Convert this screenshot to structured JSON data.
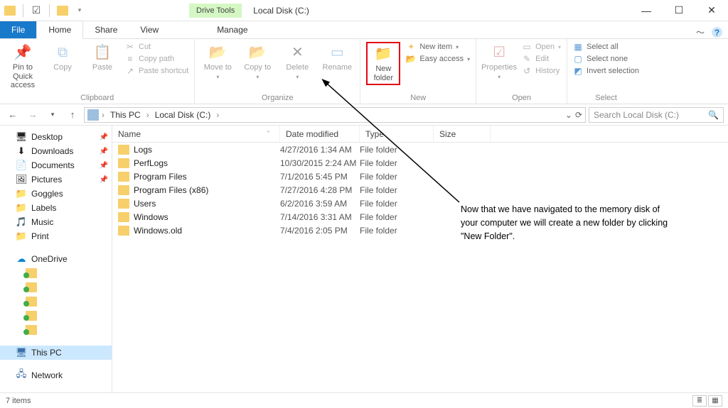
{
  "window": {
    "title": "Local Disk (C:)",
    "drive_tools": "Drive Tools"
  },
  "tabs": {
    "file": "File",
    "home": "Home",
    "share": "Share",
    "view": "View",
    "manage": "Manage"
  },
  "ribbon": {
    "clipboard": {
      "label": "Clipboard",
      "pin": "Pin to Quick access",
      "copy": "Copy",
      "paste": "Paste",
      "cut": "Cut",
      "copy_path": "Copy path",
      "paste_shortcut": "Paste shortcut"
    },
    "organize": {
      "label": "Organize",
      "move_to": "Move to",
      "copy_to": "Copy to",
      "delete": "Delete",
      "rename": "Rename"
    },
    "new": {
      "label": "New",
      "new_folder": "New folder",
      "new_item": "New item",
      "easy_access": "Easy access"
    },
    "open": {
      "label": "Open",
      "properties": "Properties",
      "open": "Open",
      "edit": "Edit",
      "history": "History"
    },
    "select": {
      "label": "Select",
      "select_all": "Select all",
      "select_none": "Select none",
      "invert": "Invert selection"
    }
  },
  "breadcrumb": {
    "root": "This PC",
    "current": "Local Disk (C:)"
  },
  "search": {
    "placeholder": "Search Local Disk (C:)"
  },
  "sidebar": {
    "quick": [
      {
        "label": "Desktop",
        "pin": true,
        "icon": "🖥"
      },
      {
        "label": "Downloads",
        "pin": true,
        "icon": "⬇"
      },
      {
        "label": "Documents",
        "pin": true,
        "icon": "📄"
      },
      {
        "label": "Pictures",
        "pin": true,
        "icon": "🖼"
      },
      {
        "label": "Goggles",
        "pin": false,
        "icon": "📁"
      },
      {
        "label": "Labels",
        "pin": false,
        "icon": "📁"
      },
      {
        "label": "Music",
        "pin": false,
        "icon": "🎵"
      },
      {
        "label": "Print",
        "pin": false,
        "icon": "📁"
      }
    ],
    "onedrive": "OneDrive",
    "thispc": "This PC",
    "network": "Network"
  },
  "columns": {
    "name": "Name",
    "date": "Date modified",
    "type": "Type",
    "size": "Size"
  },
  "files": [
    {
      "name": "Logs",
      "date": "4/27/2016 1:34 AM",
      "type": "File folder"
    },
    {
      "name": "PerfLogs",
      "date": "10/30/2015 2:24 AM",
      "type": "File folder"
    },
    {
      "name": "Program Files",
      "date": "7/1/2016 5:45 PM",
      "type": "File folder"
    },
    {
      "name": "Program Files (x86)",
      "date": "7/27/2016 4:28 PM",
      "type": "File folder"
    },
    {
      "name": "Users",
      "date": "6/2/2016 3:59 AM",
      "type": "File folder"
    },
    {
      "name": "Windows",
      "date": "7/14/2016 3:31 AM",
      "type": "File folder"
    },
    {
      "name": "Windows.old",
      "date": "7/4/2016 2:05 PM",
      "type": "File folder"
    }
  ],
  "status": {
    "count": "7 items"
  },
  "annotation": {
    "line1": "Now that we have navigated to the memory disk of",
    "line2": "your computer we will create a new folder by clicking",
    "line3": "\"New Folder\"."
  }
}
